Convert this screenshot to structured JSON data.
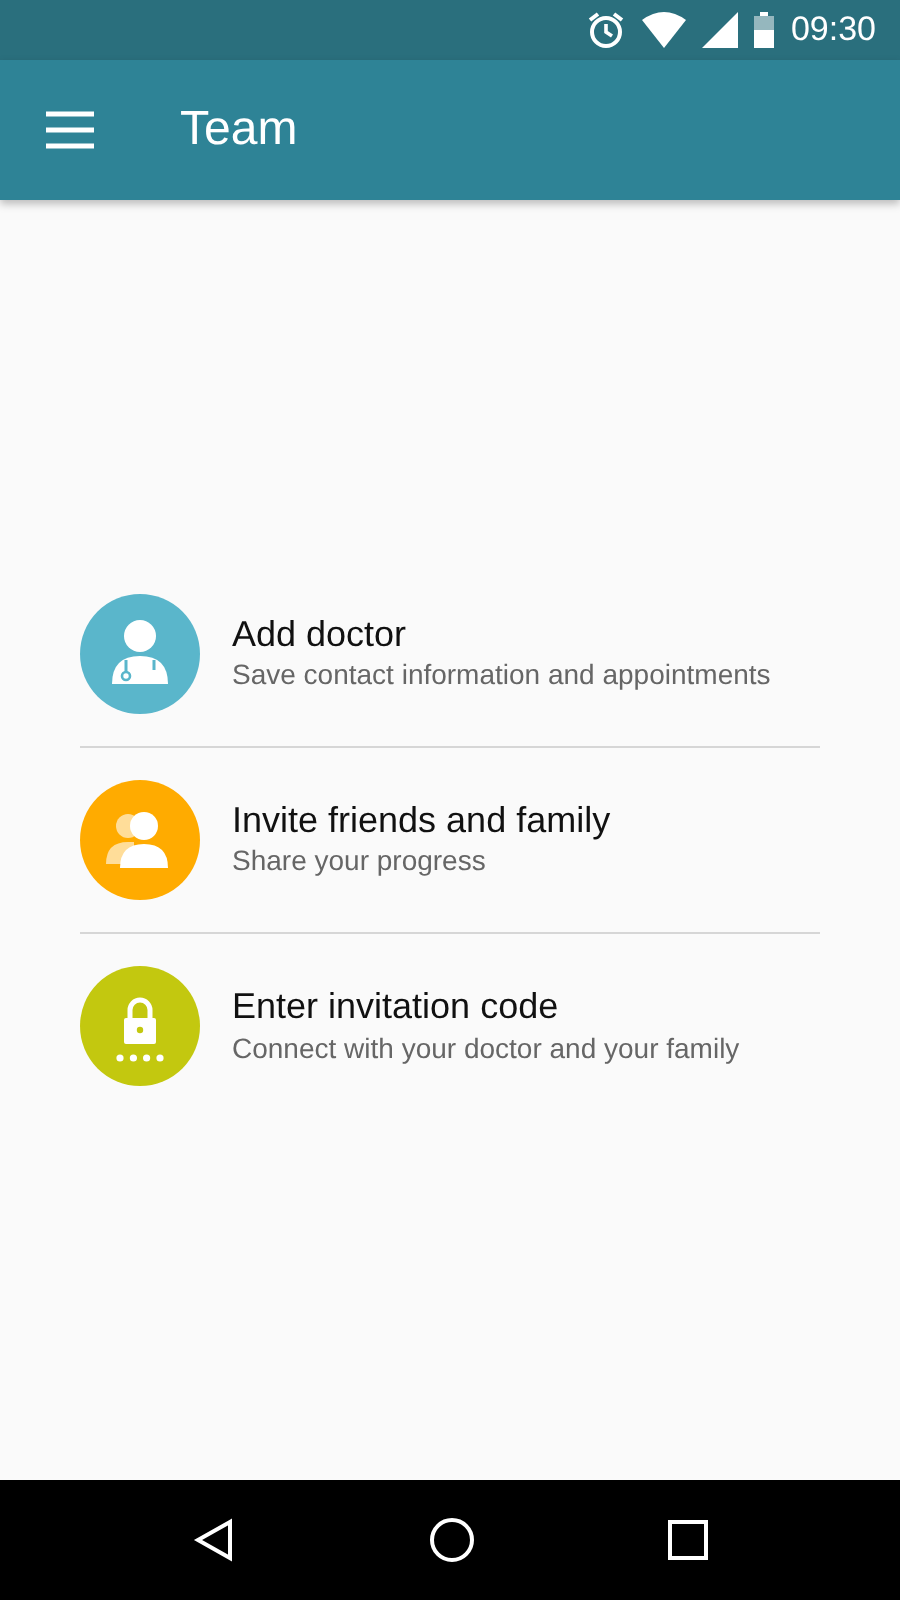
{
  "status_bar": {
    "time": "09:30"
  },
  "app_bar": {
    "title": "Team"
  },
  "items": [
    {
      "kind": "doctor",
      "color": "#5ab6cb",
      "title": "Add doctor",
      "subtitle": "Save contact information and appointments"
    },
    {
      "kind": "people",
      "color": "#ffab00",
      "title": "Invite friends and family",
      "subtitle": "Share your progress"
    },
    {
      "kind": "code",
      "color": "#c3c80f",
      "title": "Enter invitation code",
      "subtitle": "Connect with your doctor and your family"
    }
  ]
}
